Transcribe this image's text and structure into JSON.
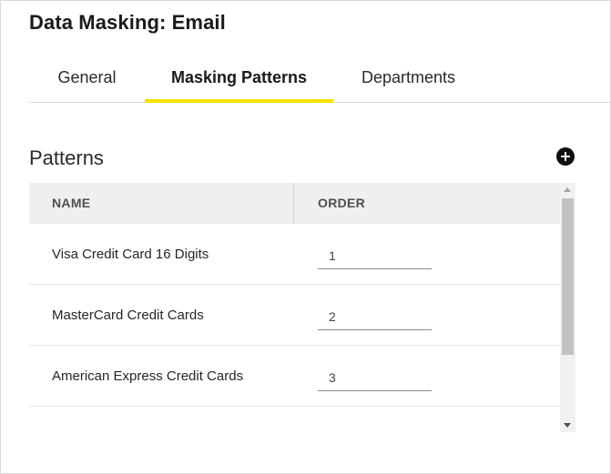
{
  "page": {
    "title": "Data Masking: Email"
  },
  "tabs": [
    {
      "label": "General",
      "active": false
    },
    {
      "label": "Masking Patterns",
      "active": true
    },
    {
      "label": "Departments",
      "active": false
    }
  ],
  "patterns": {
    "title": "Patterns",
    "add_icon": "plus-circle-icon",
    "columns": {
      "name": "NAME",
      "order": "ORDER"
    },
    "rows": [
      {
        "name": "Visa Credit Card 16 Digits",
        "order": "1"
      },
      {
        "name": "MasterCard Credit Cards",
        "order": "2"
      },
      {
        "name": "American Express Credit Cards",
        "order": "3"
      }
    ]
  },
  "colors": {
    "active_tab_underline": "#f5e100",
    "header_background": "#efefef",
    "add_button": "#0f0f0f"
  }
}
